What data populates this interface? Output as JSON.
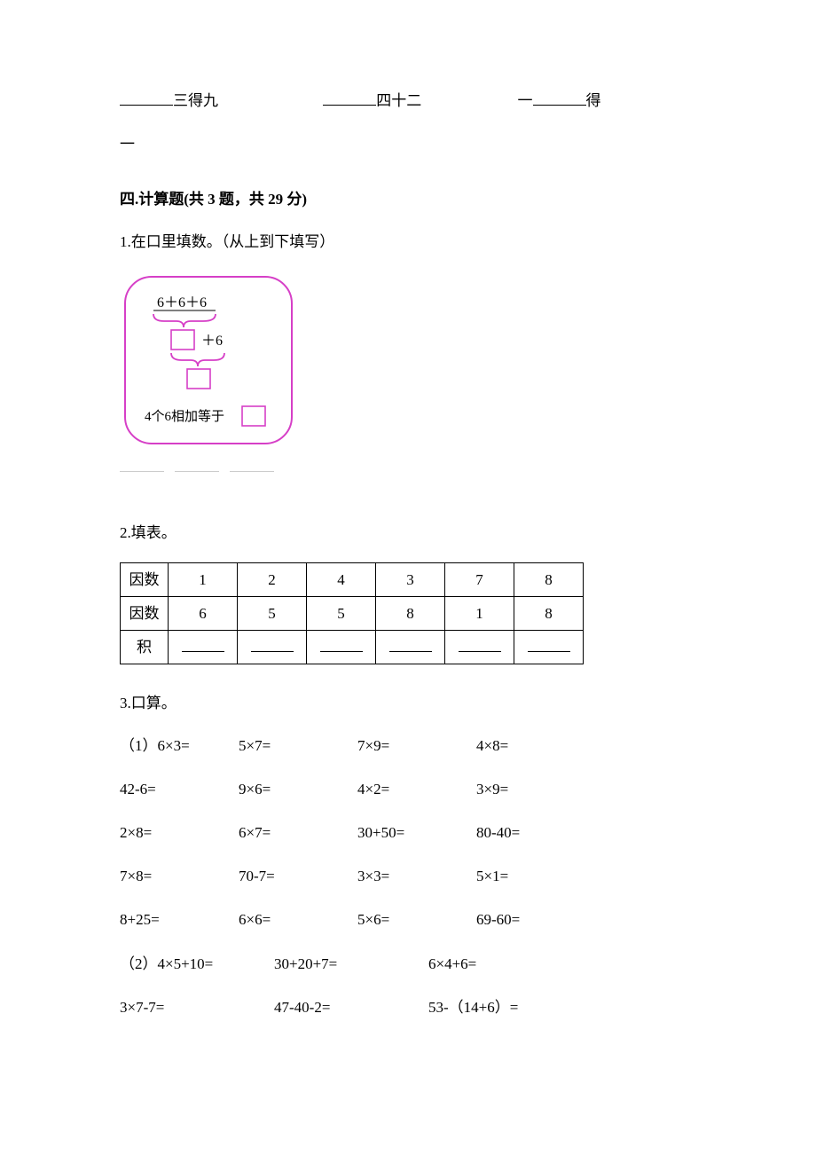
{
  "top_fill": {
    "seg1_suffix": "三得九",
    "seg2_suffix": "四十二",
    "seg3_prefix": "一",
    "seg3_suffix": "得",
    "line2": "一"
  },
  "section4": {
    "title": "四.计算题(共 3 题，共 29 分)",
    "q1": {
      "prompt": "1.在口里填数。（从上到下填写）",
      "diagram": {
        "top_text": "6＋6＋6",
        "plus6": "＋6",
        "bottom_text": "4个6相加等于"
      }
    },
    "q2": {
      "prompt": "2.填表。",
      "headers": [
        "因数",
        "因数",
        "积"
      ],
      "row1": [
        "1",
        "2",
        "4",
        "3",
        "7",
        "8"
      ],
      "row2": [
        "6",
        "5",
        "5",
        "8",
        "1",
        "8"
      ]
    },
    "q3": {
      "prompt": "3.口算。",
      "rows": [
        [
          "（1）6×3=",
          "5×7=",
          "7×9=",
          "4×8="
        ],
        [
          "42-6=",
          "9×6=",
          "4×2=",
          "3×9="
        ],
        [
          "2×8=",
          "6×7=",
          "30+50=",
          "80-40="
        ],
        [
          "7×8=",
          "70-7=",
          "3×3=",
          "5×1="
        ],
        [
          "8+25=",
          "6×6=",
          "5×6=",
          "69-60="
        ],
        [
          "（2）4×5+10=",
          "30+20+7=",
          "6×4+6="
        ],
        [
          "3×7-7=",
          "47-40-2=",
          "53-（14+6）="
        ]
      ]
    }
  }
}
